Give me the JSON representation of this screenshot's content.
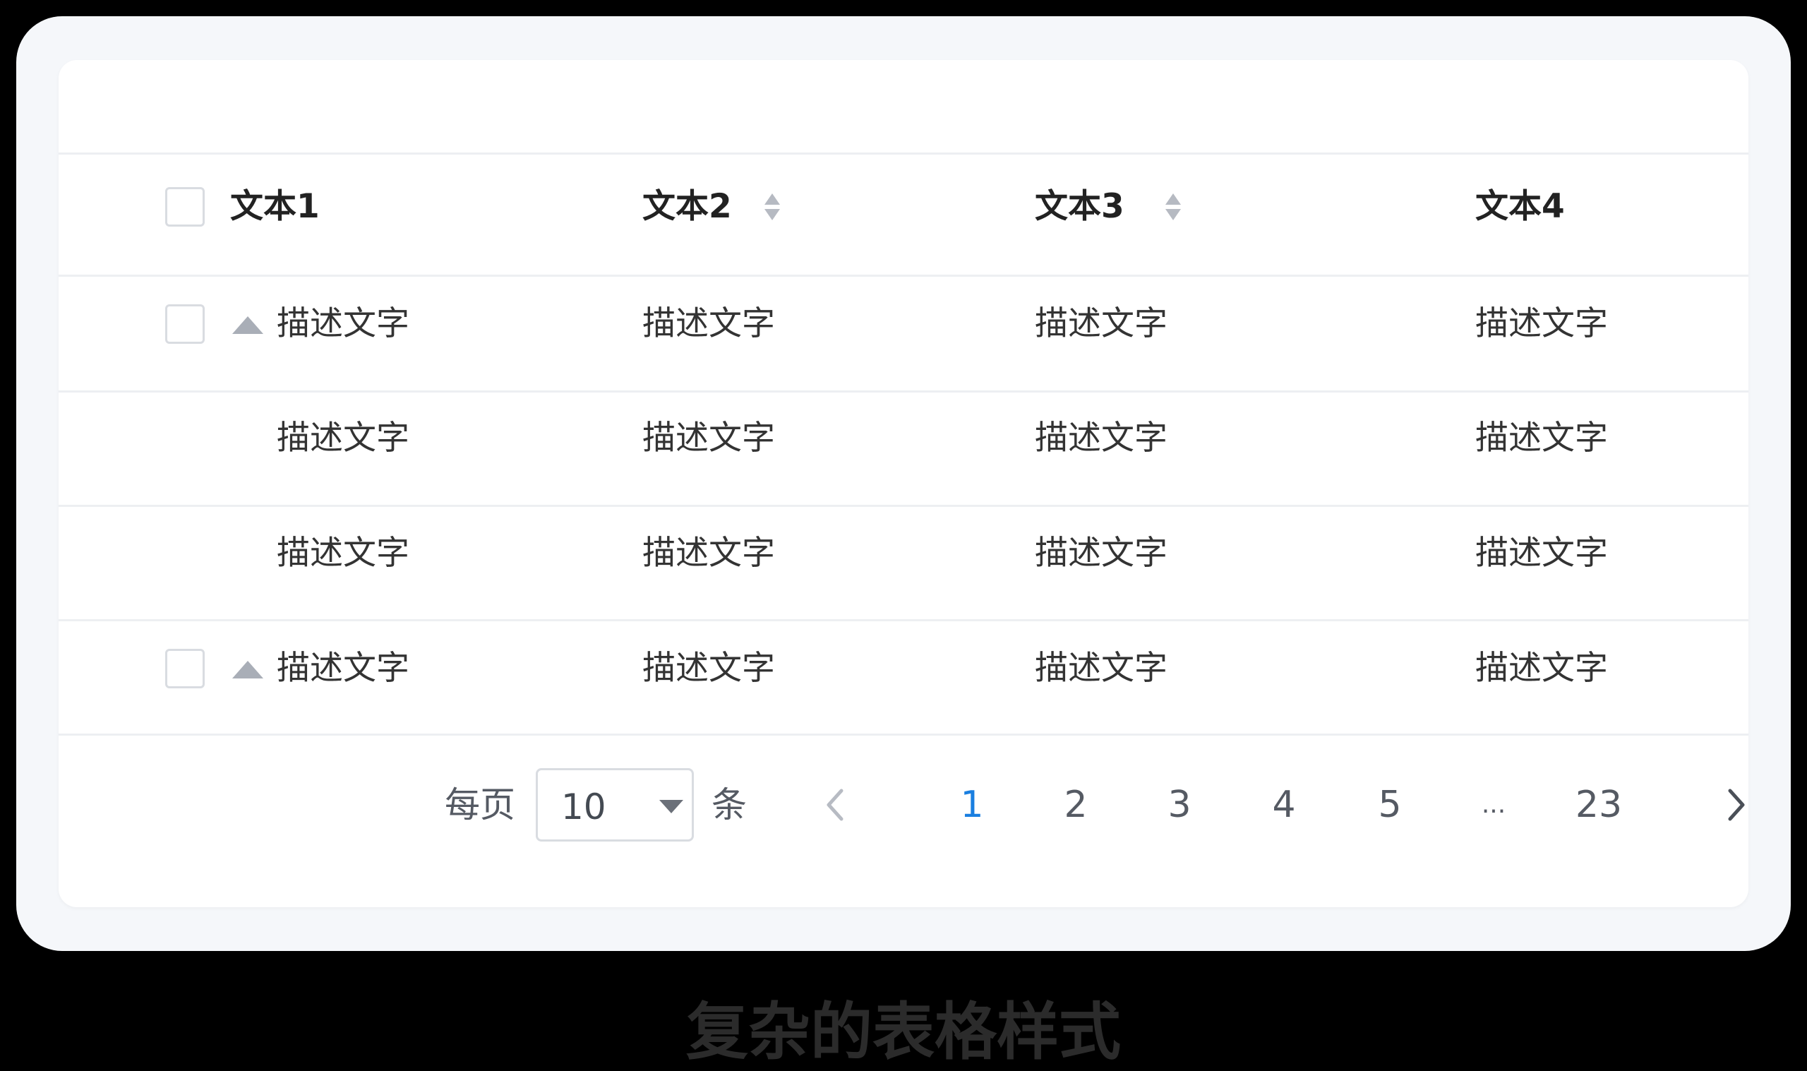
{
  "table": {
    "headers": [
      "文本1",
      "文本2",
      "文本3",
      "文本4"
    ],
    "rows": [
      [
        "描述文字",
        "描述文字",
        "描述文字",
        "描述文字"
      ],
      [
        "描述文字",
        "描述文字",
        "描述文字",
        "描述文字"
      ],
      [
        "描述文字",
        "描述文字",
        "描述文字",
        "描述文字"
      ],
      [
        "描述文字",
        "描述文字",
        "描述文字",
        "描述文字"
      ]
    ]
  },
  "pagination": {
    "per_page_label": "每页",
    "page_size": "10",
    "unit_label": "条",
    "pages": [
      "1",
      "2",
      "3",
      "4",
      "5",
      "...",
      "23"
    ],
    "current_page": "1"
  },
  "caption": "复杂的表格样式",
  "colors": {
    "accent": "#1a7fe0",
    "text": "#333333",
    "border": "#d9dce1",
    "frame": "#f5f7fa"
  },
  "icons": {
    "sort": "sort-icon",
    "expand": "caret-up-icon",
    "select_caret": "caret-down-icon",
    "prev": "chevron-left-icon",
    "next": "chevron-right-icon"
  }
}
